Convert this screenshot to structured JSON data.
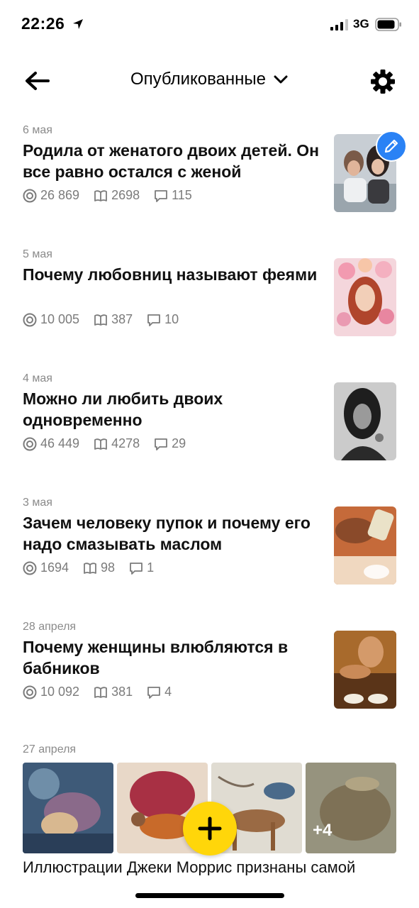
{
  "status": {
    "time": "22:26",
    "network": "3G"
  },
  "nav": {
    "title": "Опубликованные"
  },
  "articles": [
    {
      "date": "6 мая",
      "title": "Родила от женатого двоих детей. Он все равно остался с женой",
      "views": "26 869",
      "reads": "2698",
      "comments": "115"
    },
    {
      "date": "5 мая",
      "title": "Почему любовниц называют феями",
      "views": "10 005",
      "reads": "387",
      "comments": "10"
    },
    {
      "date": "4 мая",
      "title": "Можно ли любить двоих одновременно",
      "views": "46 449",
      "reads": "4278",
      "comments": "29"
    },
    {
      "date": "3 мая",
      "title": "Зачем человеку пупок и почему его надо смазывать маслом",
      "views": "1694",
      "reads": "98",
      "comments": "1"
    },
    {
      "date": "28 апреля",
      "title": "Почему женщины влюбляются в бабников",
      "views": "10 092",
      "reads": "381",
      "comments": "4"
    }
  ],
  "gallery": {
    "date": "27 апреля",
    "more_count": "+4",
    "caption": "Иллюстрации Джеки Моррис признаны самой"
  },
  "icons": {
    "back": "arrow-left-icon",
    "chevron": "chevron-down-icon",
    "settings": "gear-icon",
    "views": "eye-icon",
    "reads": "book-icon",
    "comments": "comment-icon",
    "edit": "pencil-icon",
    "add": "plus-icon"
  },
  "colors": {
    "accent_blue": "#2a82f5",
    "fab_yellow": "#ffd60a",
    "meta_gray": "#8a8a8a"
  }
}
